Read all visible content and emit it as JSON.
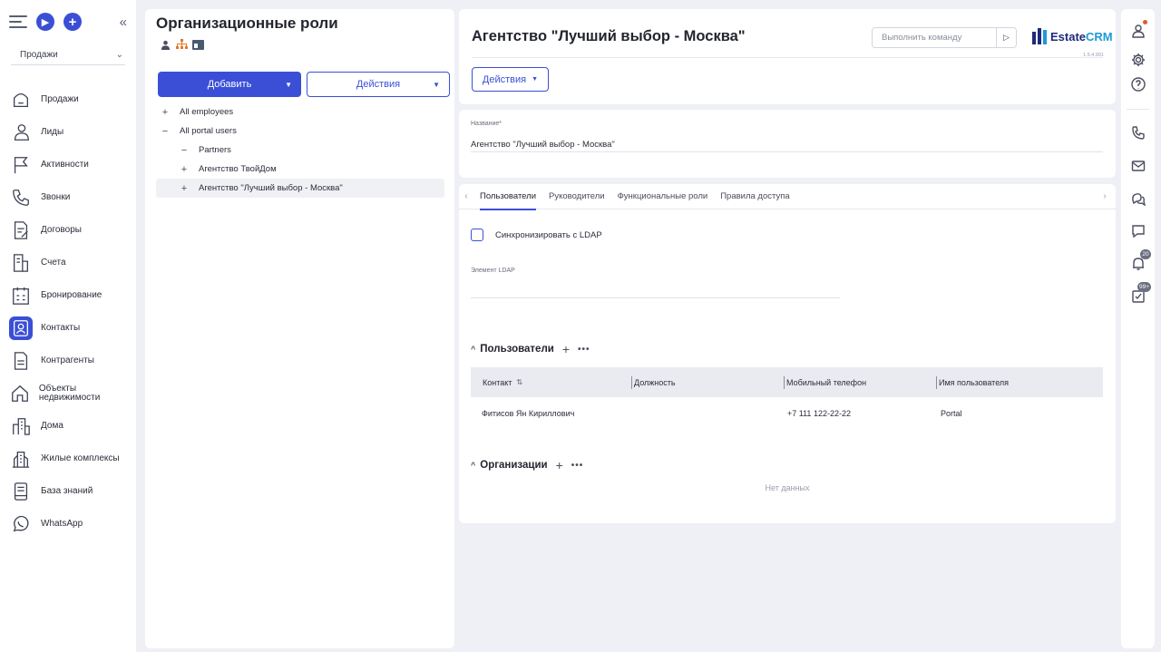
{
  "sidebar": {
    "select_value": "Продажи",
    "items": [
      {
        "label": "Продажи",
        "icon": "sales-icon"
      },
      {
        "label": "Лиды",
        "icon": "leads-icon"
      },
      {
        "label": "Активности",
        "icon": "flag-icon"
      },
      {
        "label": "Звонки",
        "icon": "phone-icon"
      },
      {
        "label": "Договоры",
        "icon": "contract-icon"
      },
      {
        "label": "Счета",
        "icon": "invoice-icon"
      },
      {
        "label": "Бронирование",
        "icon": "calendar-icon"
      },
      {
        "label": "Контакты",
        "icon": "contacts-icon"
      },
      {
        "label": "Контрагенты",
        "icon": "document-icon"
      },
      {
        "label": "Объекты недвижимости",
        "icon": "house-icon"
      },
      {
        "label": "Дома",
        "icon": "buildings-icon"
      },
      {
        "label": "Жилые комплексы",
        "icon": "complex-icon"
      },
      {
        "label": "База знаний",
        "icon": "book-icon"
      },
      {
        "label": "WhatsApp",
        "icon": "whatsapp-icon"
      }
    ]
  },
  "tree_panel": {
    "title": "Организационные роли",
    "add_label": "Добавить",
    "actions_label": "Действия",
    "nodes": [
      {
        "toggle": "+",
        "label": "All employees"
      },
      {
        "toggle": "−",
        "label": "All portal users"
      },
      {
        "toggle": "−",
        "label": "Partners"
      },
      {
        "toggle": "+",
        "label": "Агентство ТвойДом"
      },
      {
        "toggle": "+",
        "label": "Агентство \"Лучший выбор - Москва\""
      }
    ]
  },
  "main": {
    "title": "Агентство \"Лучший выбор - Москва\"",
    "command_placeholder": "Выполнить команду",
    "logo": {
      "part1": "Estate",
      "part2": "CRM"
    },
    "version": "1.5.4.901",
    "actions_label": "Действия",
    "name_field": {
      "label": "Название*",
      "value": "Агентство \"Лучший выбор - Москва\""
    },
    "tabs": [
      "Пользователи",
      "Руководители",
      "Функциональные роли",
      "Правила доступа"
    ],
    "sync_label": "Синхронизировать с LDAP",
    "ldap_label": "Элемент LDAP",
    "users_section": {
      "title": "Пользователи",
      "columns": [
        "Контакт",
        "Должность",
        "Мобильный телефон",
        "Имя пользователя"
      ],
      "rows": [
        {
          "contact": "Фитисов Ян Кириллович",
          "position": "",
          "phone": "+7 111 122-22-22",
          "username": "Portal"
        }
      ]
    },
    "orgs_section": {
      "title": "Организации",
      "empty_text": "Нет данных"
    }
  },
  "rail": {
    "notifications_count": "20",
    "tasks_count": "99+"
  },
  "colors": {
    "accent": "#3a4fd6",
    "logo_dark": "#1e2a78",
    "logo_light": "#1c9ad6"
  }
}
